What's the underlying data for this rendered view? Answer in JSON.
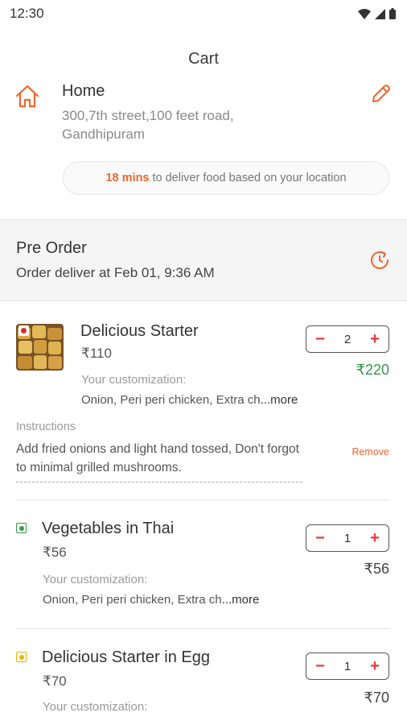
{
  "status_bar": {
    "time": "12:30"
  },
  "page": {
    "title": "Cart"
  },
  "address": {
    "label": "Home",
    "line": "300,7th street,100 feet road, Gandhipuram"
  },
  "eta": {
    "minutes": "18 mins",
    "text": "to deliver food based on your location"
  },
  "pre_order": {
    "title": "Pre Order",
    "subtitle": "Order deliver at Feb 01, 9:36 AM"
  },
  "items": [
    {
      "name": "Delicious Starter",
      "price": "₹110",
      "quantity": "2",
      "total": "₹220",
      "customization_label": "Your customization:",
      "customization": "Onion, Peri peri chicken, Extra ch",
      "more": "...more",
      "instructions_label": "Instructions",
      "instructions": "Add fried onions and light hand tossed, Don't forgot to minimal grilled mushrooms.",
      "remove": "Remove"
    },
    {
      "name": "Vegetables in Thai",
      "price": "₹56",
      "quantity": "1",
      "total": "₹56",
      "customization_label": "Your customization:",
      "customization": "Onion, Peri peri chicken, Extra ch",
      "more": "...more",
      "indicator_color": "#2e9a47"
    },
    {
      "name": "Delicious Starter in Egg",
      "price": "₹70",
      "quantity": "1",
      "total": "₹70",
      "customization_label": "Your customization:",
      "indicator_color": "#e8b400"
    }
  ],
  "stepper": {
    "minus": "−",
    "plus": "+"
  },
  "colors": {
    "accent": "#f0652d",
    "total_green": "#2e9a47",
    "stepper_red": "#e53935"
  },
  "icons": [
    "wifi-icon",
    "signal-icon",
    "battery-icon",
    "home-icon",
    "edit-pencil-icon",
    "clock-refresh-icon",
    "veg-indicator-icon",
    "egg-indicator-icon"
  ]
}
